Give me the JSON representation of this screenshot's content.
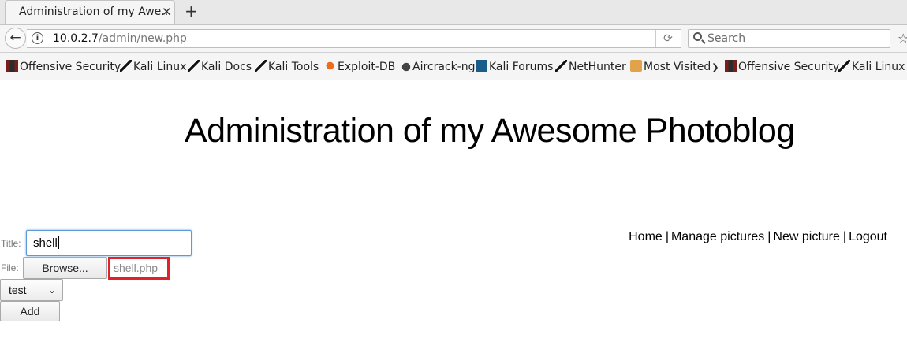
{
  "browser": {
    "tab_title": "Administration of my Awe...",
    "tab_close": "✕",
    "new_tab": "+",
    "url_host": "10.0.2.7",
    "url_path": "/admin/new.php",
    "search_placeholder": "Search"
  },
  "bookmarks": [
    {
      "label": "Offensive Security",
      "icon": "offsec-icon"
    },
    {
      "label": "Kali Linux",
      "icon": "kali-icon"
    },
    {
      "label": "Kali Docs",
      "icon": "kali-icon"
    },
    {
      "label": "Kali Tools",
      "icon": "kali-icon"
    },
    {
      "label": "Exploit-DB",
      "icon": "exploit-db-icon"
    },
    {
      "label": "Aircrack-ng",
      "icon": "aircrack-icon"
    },
    {
      "label": "Kali Forums",
      "icon": "forums-icon"
    },
    {
      "label": "NetHunter",
      "icon": "kali-icon"
    },
    {
      "label": "Most Visited",
      "icon": "folder-icon"
    },
    {
      "label": "Offensive Security",
      "icon": "offsec-icon"
    },
    {
      "label": "Kali Linux",
      "icon": "kali-icon"
    }
  ],
  "page": {
    "heading": "Administration of my Awesome Photoblog",
    "nav": {
      "home": "Home",
      "manage": "Manage pictures",
      "new": "New picture",
      "logout": "Logout",
      "separator": "|"
    },
    "form": {
      "title_label": "Title:",
      "title_value": "shell",
      "file_label": "File:",
      "browse_label": "Browse...",
      "file_name": "shell.php",
      "category_selected": "test",
      "submit_label": "Add"
    }
  },
  "colors": {
    "highlight_box": "#e0232a",
    "focus_border": "#5b9bd5"
  }
}
